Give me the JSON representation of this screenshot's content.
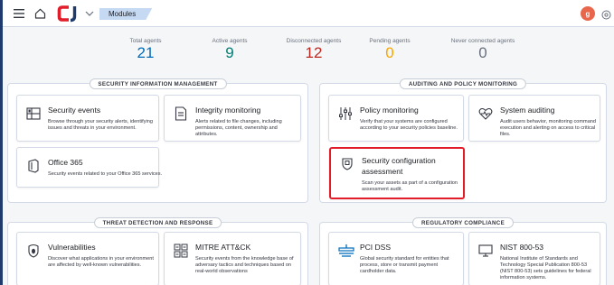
{
  "header": {
    "breadcrumb": "Modules",
    "avatar_initial": "g"
  },
  "stats": [
    {
      "label": "Total agents",
      "value": "21",
      "color": "#006bb8"
    },
    {
      "label": "Active agents",
      "value": "9",
      "color": "#017d73"
    },
    {
      "label": "Disconnected agents",
      "value": "12",
      "color": "#bd271e"
    },
    {
      "label": "Pending agents",
      "value": "0",
      "color": "#f5a700"
    },
    {
      "label": "Never connected agents",
      "value": "0",
      "color": "#69707d"
    }
  ],
  "sections": {
    "sim": {
      "title": "SECURITY INFORMATION MANAGEMENT",
      "cards": [
        {
          "title": "Security events",
          "desc": "Browse through your security alerts, identifying issues and threats in your environment.",
          "icon": "security-events-icon"
        },
        {
          "title": "Integrity monitoring",
          "desc": "Alerts related to file changes, including permissions, content, ownership and attributes.",
          "icon": "file-icon"
        },
        {
          "title": "Office 365",
          "desc": "Security events related to your Office 365 services.",
          "icon": "office-icon"
        }
      ]
    },
    "aud": {
      "title": "AUDITING AND POLICY MONITORING",
      "cards": [
        {
          "title": "Policy monitoring",
          "desc": "Verify that your systems are configured according to your security policies baseline.",
          "icon": "sliders-icon"
        },
        {
          "title": "System auditing",
          "desc": "Audit users behavior, monitoring command execution and alerting on access to critical files.",
          "icon": "heartbeat-icon"
        },
        {
          "title_line1": "Security configuration",
          "title_line2": "assessment",
          "desc": "Scan your assets as part of a configuration assessment audit.",
          "icon": "shield-icon"
        }
      ]
    },
    "tdr": {
      "title": "THREAT DETECTION AND RESPONSE",
      "cards": [
        {
          "title": "Vulnerabilities",
          "desc": "Discover what applications in your environment are affected by well-known vulnerabilities.",
          "icon": "bug-shield-icon"
        },
        {
          "title": "MITRE ATT&CK",
          "desc": "Security events from the knowledge base of adversary tactics and techniques based on real-world observations",
          "icon": "grid-icon"
        }
      ]
    },
    "reg": {
      "title": "REGULATORY COMPLIANCE",
      "cards": [
        {
          "title": "PCI DSS",
          "desc": "Global security standard for entities that process, store or transmit payment cardholder data.",
          "icon": "card-reader-icon"
        },
        {
          "title": "NIST 800-53",
          "desc": "National Institute of Standards and Technology Special Publication 800-53 (NIST 800-53) sets guidelines for federal information systems.",
          "icon": "monitor-icon"
        }
      ]
    }
  },
  "colors": {
    "highlight": "#e11d2a",
    "brand": "#e11d2a",
    "brand_dark": "#1f3b6e"
  }
}
